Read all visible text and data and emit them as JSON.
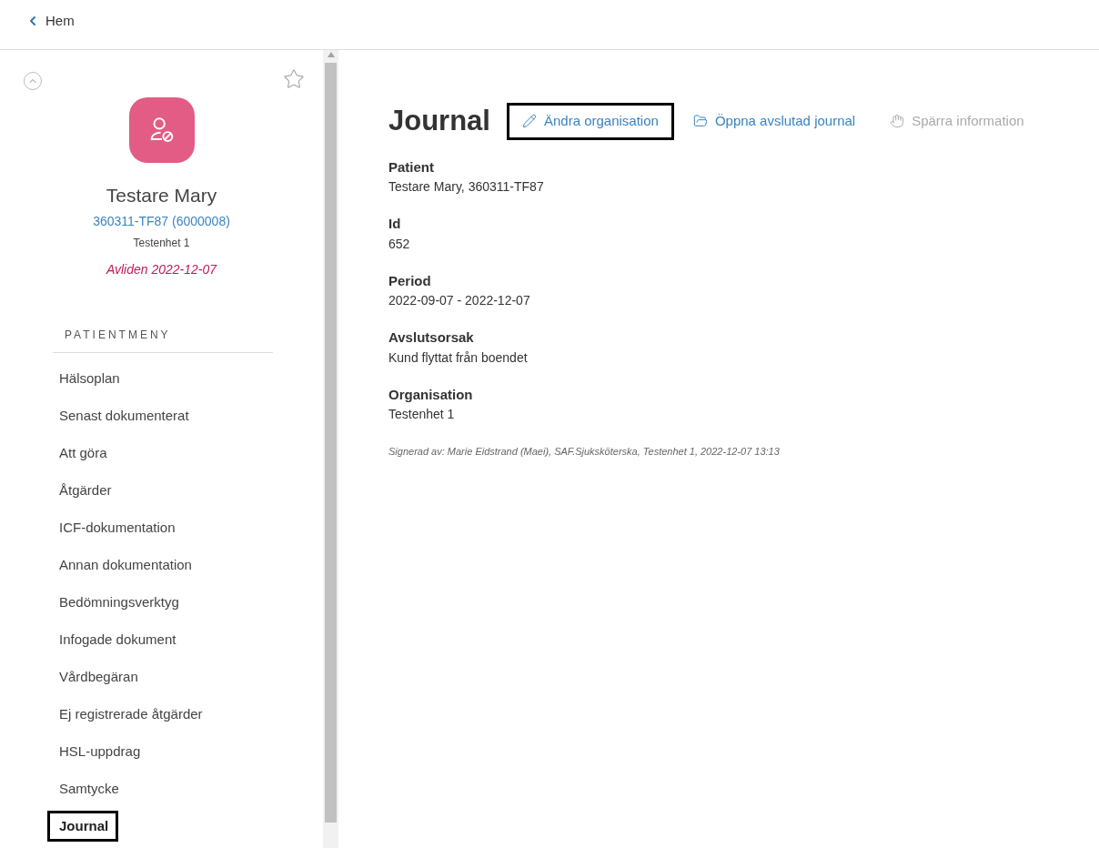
{
  "back_link": {
    "label": "Hem"
  },
  "patient": {
    "name": "Testare Mary",
    "id_link": "360311-TF87 (6000008)",
    "unit": "Testenhet 1",
    "deceased": "Avliden 2022-12-07"
  },
  "menu": {
    "heading": "PATIENTMENY",
    "items": [
      {
        "label": "Hälsoplan",
        "selected": false,
        "highlighted": false
      },
      {
        "label": "Senast dokumenterat",
        "selected": false,
        "highlighted": false
      },
      {
        "label": "Att göra",
        "selected": false,
        "highlighted": false
      },
      {
        "label": "Åtgärder",
        "selected": false,
        "highlighted": false
      },
      {
        "label": "ICF-dokumentation",
        "selected": false,
        "highlighted": false
      },
      {
        "label": "Annan dokumentation",
        "selected": false,
        "highlighted": false
      },
      {
        "label": "Bedömningsverktyg",
        "selected": false,
        "highlighted": false
      },
      {
        "label": "Infogade dokument",
        "selected": false,
        "highlighted": false
      },
      {
        "label": "Vårdbegäran",
        "selected": false,
        "highlighted": false
      },
      {
        "label": "Ej registrerade åtgärder",
        "selected": false,
        "highlighted": false
      },
      {
        "label": "HSL-uppdrag",
        "selected": false,
        "highlighted": false
      },
      {
        "label": "Samtycke",
        "selected": false,
        "highlighted": false
      },
      {
        "label": "Journal",
        "selected": true,
        "highlighted": true
      }
    ]
  },
  "title": "Journal",
  "actions": [
    {
      "kind": "edit",
      "label": "Ändra organisation",
      "disabled": false,
      "highlighted": true
    },
    {
      "kind": "folder",
      "label": "Öppna avslutad journal",
      "disabled": false,
      "highlighted": false
    },
    {
      "kind": "hand",
      "label": "Spärra information",
      "disabled": true,
      "highlighted": false
    }
  ],
  "fields": [
    {
      "label": "Patient",
      "value": "Testare Mary, 360311-TF87"
    },
    {
      "label": "Id",
      "value": "652"
    },
    {
      "label": "Period",
      "value": "2022-09-07 - 2022-12-07"
    },
    {
      "label": "Avslutsorsak",
      "value": "Kund flyttat från boendet"
    },
    {
      "label": "Organisation",
      "value": "Testenhet 1"
    }
  ],
  "signature": "Signerad av: Marie Eidstrand (Maei), SAF.Sjuksköterska, Testenhet 1, 2022-12-07 13:13"
}
